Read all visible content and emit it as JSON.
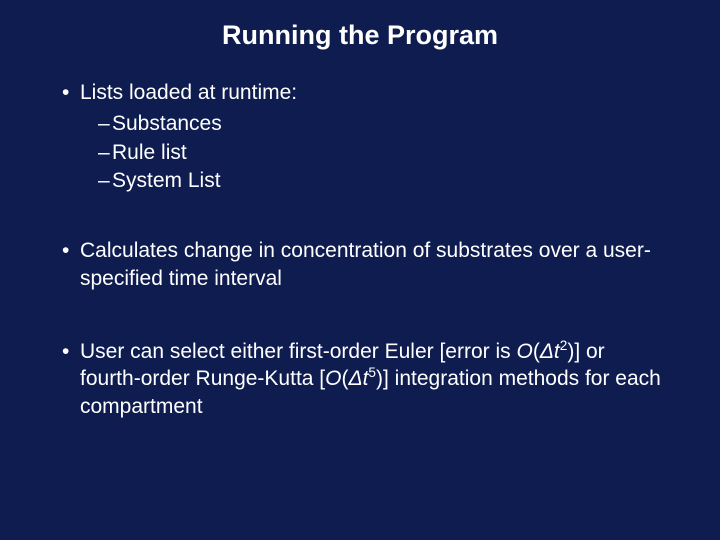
{
  "title": "Running the Program",
  "bullets": {
    "b1": "Lists loaded at runtime:",
    "b1a": "Substances",
    "b1b": "Rule list",
    "b1c": "System List",
    "b2": "Calculates change in concentration of substrates over a user-specified time interval",
    "b3_pre": "User can select either first-order Euler [error is ",
    "b3_O1": "O",
    "b3_paren1": "(",
    "b3_dt1": "Δt",
    "b3_exp1": "2",
    "b3_close1": ")] or fourth-order Runge-Kutta [",
    "b3_O2": "O",
    "b3_paren2": "(",
    "b3_dt2": "Δt",
    "b3_exp2": "5",
    "b3_close2": ")] integration methods for each compartment"
  }
}
